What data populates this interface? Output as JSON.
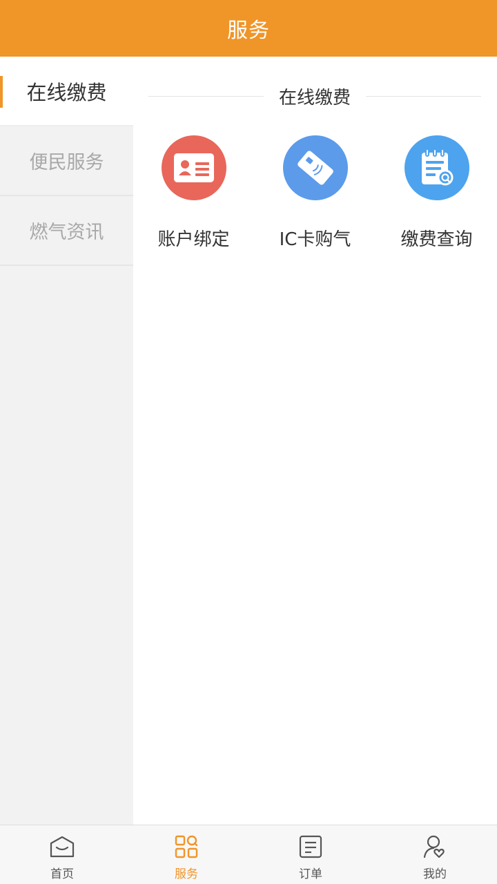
{
  "header": {
    "title": "服务"
  },
  "sidebar": {
    "items": [
      {
        "label": "在线缴费",
        "active": true
      },
      {
        "label": "便民服务",
        "active": false
      },
      {
        "label": "燃气资讯",
        "active": false
      }
    ]
  },
  "content": {
    "section_title": "在线缴费",
    "items": [
      {
        "label": "账户绑定",
        "icon": "id-card-icon",
        "color": "#E8675A"
      },
      {
        "label": "IC卡购气",
        "icon": "ic-card-icon",
        "color": "#5B9BEA"
      },
      {
        "label": "缴费查询",
        "icon": "bill-search-icon",
        "color": "#4DA3EE"
      }
    ]
  },
  "tabbar": {
    "items": [
      {
        "label": "首页",
        "icon": "home-icon",
        "active": false
      },
      {
        "label": "服务",
        "icon": "grid-icon",
        "active": true
      },
      {
        "label": "订单",
        "icon": "order-icon",
        "active": false
      },
      {
        "label": "我的",
        "icon": "profile-icon",
        "active": false
      }
    ]
  },
  "colors": {
    "accent": "#F09528"
  }
}
